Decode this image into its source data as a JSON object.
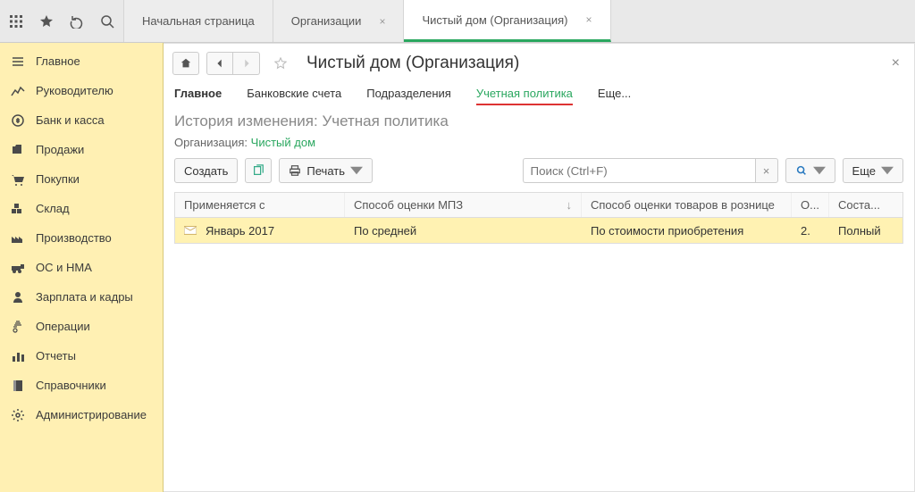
{
  "top_tabs": {
    "start": "Начальная страница",
    "orgs": "Организации",
    "active": "Чистый дом (Организация)"
  },
  "sidebar": {
    "items": [
      {
        "label": "Главное"
      },
      {
        "label": "Руководителю"
      },
      {
        "label": "Банк и касса"
      },
      {
        "label": "Продажи"
      },
      {
        "label": "Покупки"
      },
      {
        "label": "Склад"
      },
      {
        "label": "Производство"
      },
      {
        "label": "ОС и НМА"
      },
      {
        "label": "Зарплата и кадры"
      },
      {
        "label": "Операции"
      },
      {
        "label": "Отчеты"
      },
      {
        "label": "Справочники"
      },
      {
        "label": "Администрирование"
      }
    ]
  },
  "page": {
    "title": "Чистый дом (Организация)",
    "subtitle": "История изменения: Учетная политика",
    "org_label": "Организация:",
    "org_value": "Чистый дом"
  },
  "subnav": {
    "main": "Главное",
    "bank": "Банковские счета",
    "depts": "Подразделения",
    "policy": "Учетная политика",
    "more": "Еще..."
  },
  "actions": {
    "create": "Создать",
    "print": "Печать",
    "more": "Еще",
    "search_placeholder": "Поиск (Ctrl+F)"
  },
  "table": {
    "headers": {
      "applied": "Применяется с",
      "method_mpz": "Способ оценки МПЗ",
      "method_retail": "Способ оценки товаров в рознице",
      "short": "О...",
      "sostav": "Соста..."
    },
    "row": {
      "applied": "Январь 2017",
      "mpz": "По средней",
      "retail": "По стоимости приобретения",
      "short": "2.",
      "sostav": "Полный"
    }
  }
}
